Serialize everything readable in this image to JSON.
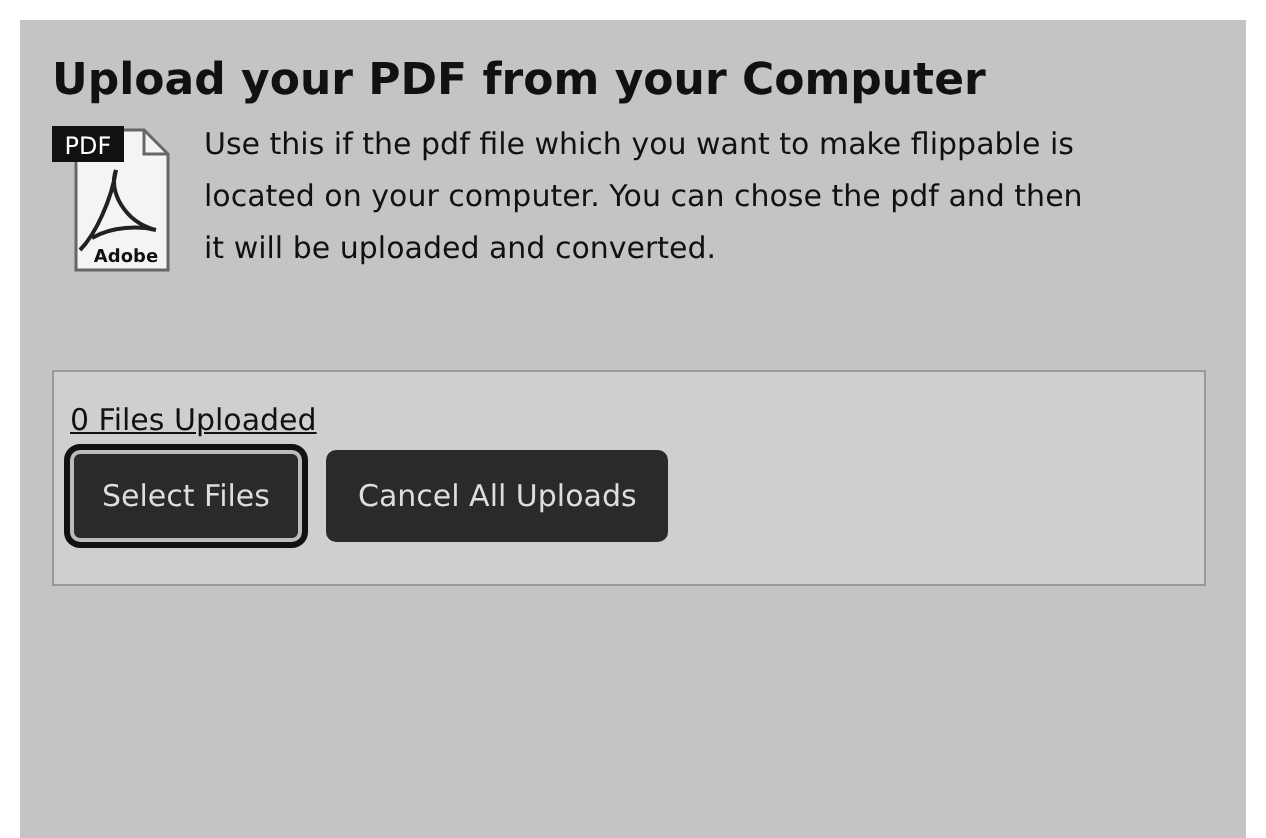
{
  "title": "Upload your PDF from your Computer",
  "file_icon": {
    "badge": "PDF",
    "brand": "Adobe"
  },
  "description": "Use this if the pdf file which you want to make flippable is located on your computer. You can chose the pdf and then it will be uploaded and converted.",
  "uploader": {
    "status": "0 Files Uploaded",
    "buttons": [
      {
        "label": "Select Files",
        "focused": true
      },
      {
        "label": "Cancel All Uploads",
        "focused": false
      }
    ]
  }
}
